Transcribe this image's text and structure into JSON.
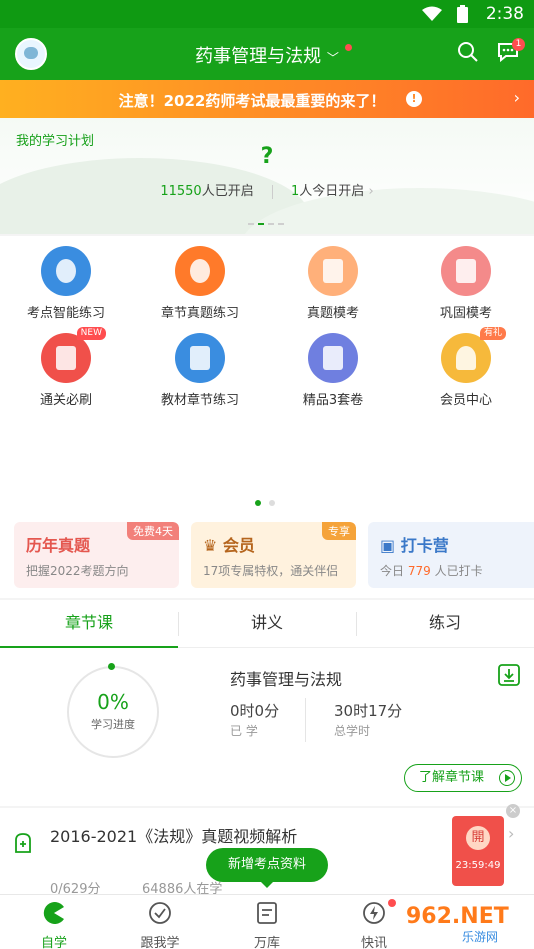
{
  "status": {
    "time": "2:38"
  },
  "appbar": {
    "title": "药事管理与法规",
    "msg_badge": "1"
  },
  "notice": {
    "text": "注意！2022药师考试最最重要的来了！",
    "info": "!",
    "arrow": "›"
  },
  "plan": {
    "label": "我的学习计划",
    "placeholder": "?",
    "started_count": "11550",
    "started_suffix": "人已开启",
    "today_count": "1",
    "today_suffix": "人今日开启",
    "arrow": "›"
  },
  "grid": {
    "items": [
      {
        "label": "考点智能练习",
        "color": "#3a8de0"
      },
      {
        "label": "章节真题练习",
        "color": "#ff7a2a"
      },
      {
        "label": "真题模考",
        "color": "#ffb07a"
      },
      {
        "label": "巩固模考",
        "color": "#f48a8a"
      },
      {
        "label": "通关必刷",
        "color": "#f0504a",
        "tag": "NEW"
      },
      {
        "label": "教材章节练习",
        "color": "#3a8de0"
      },
      {
        "label": "精品3套卷",
        "color": "#6f7fe0"
      },
      {
        "label": "会员中心",
        "color": "#f6b93b",
        "tag": "有礼"
      }
    ]
  },
  "cards": [
    {
      "title": "历年真题",
      "sub": "把握2022考题方向",
      "tag": "免费4天",
      "title_color": "#e4574f",
      "bg": "#fdeeee",
      "tag_bg": "#f2807a"
    },
    {
      "title": "会员",
      "sub": "17项专属特权，通关伴侣",
      "tag": "专享",
      "title_color": "#b5651d",
      "bg": "#fff2de",
      "tag_bg": "#f5a33a"
    },
    {
      "title": "打卡营",
      "sub_pre": "今日",
      "sub_num": "779",
      "sub_post": "人已打卡",
      "title_color": "#3a78c8",
      "bg": "#eef3fb"
    }
  ],
  "tabs": [
    "章节课",
    "讲义",
    "练习"
  ],
  "course": {
    "progress": "0%",
    "progress_label": "学习进度",
    "title": "药事管理与法规",
    "learned": "0时0分",
    "learned_label": "已 学",
    "total": "30时17分",
    "total_label": "总学时",
    "learn_button": "了解章节课"
  },
  "video": {
    "title": "2016-2021《法规》真题视频解析",
    "progress": "0/629分",
    "learners": "64886人在学",
    "promo_label": "開",
    "countdown": "23:59:49"
  },
  "float_button": "新增考点资料",
  "nav": [
    "自学",
    "跟我学",
    "万库",
    "快讯"
  ],
  "watermark": {
    "text": "962.NET",
    "sub": "乐游网"
  }
}
